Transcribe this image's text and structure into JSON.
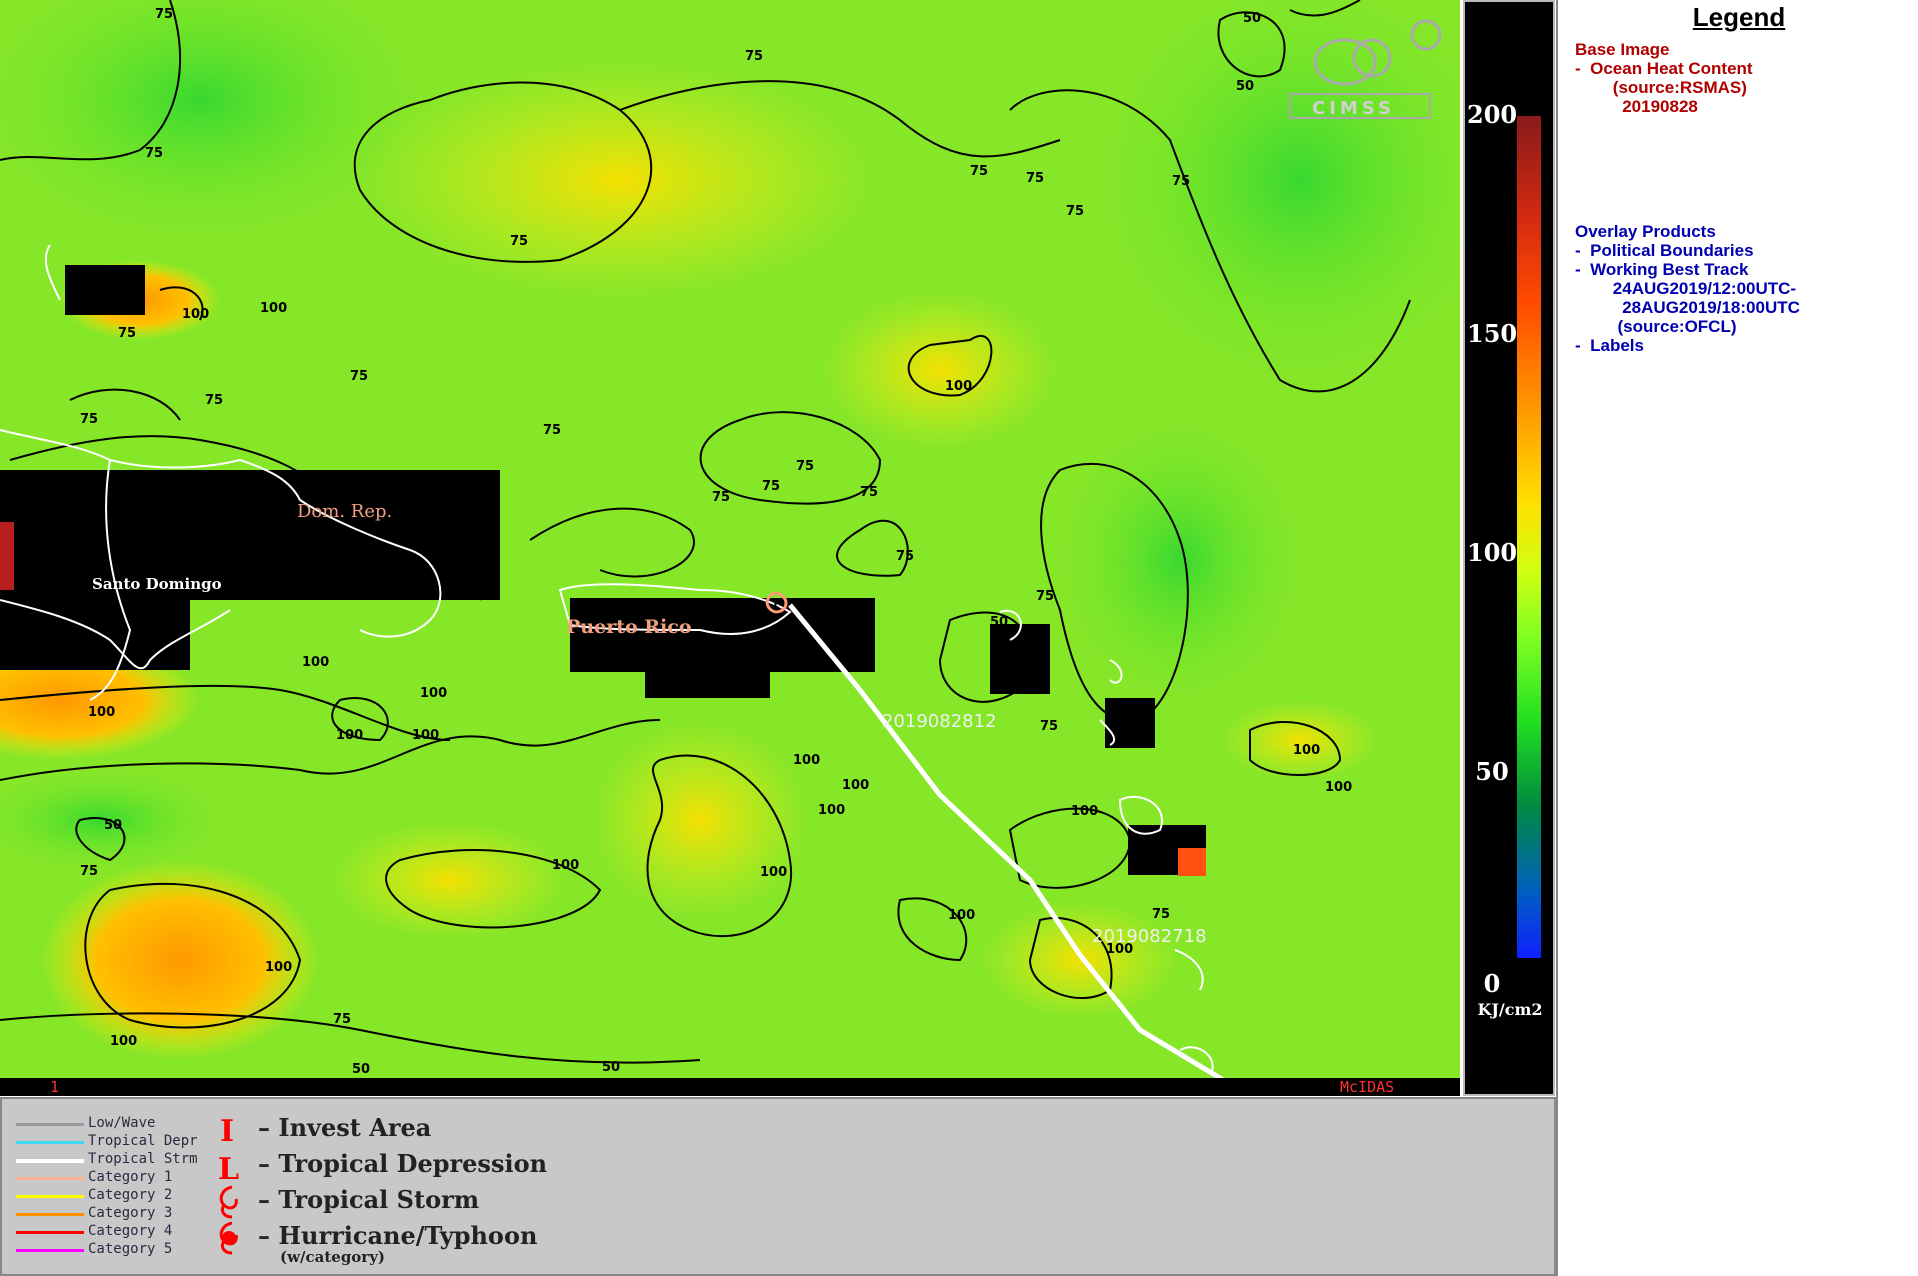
{
  "map": {
    "logo_text": "CIMSS",
    "panel_number": "1",
    "software_label": "McIDAS",
    "place_labels": [
      {
        "name": "dom-rep",
        "text": "Dom. Rep."
      },
      {
        "name": "santo-domingo",
        "text": "Santo Domingo"
      },
      {
        "name": "puerto-rico",
        "text": "Puerto Rico"
      }
    ],
    "track_date_labels": [
      "2019082812",
      "2019082718"
    ],
    "storm_symbol_number": "1",
    "contour_labels": [
      "50",
      "75",
      "100"
    ],
    "colors": {
      "track": "#ffffff",
      "storm_symbol": "#ff9c78",
      "land_mask": "#000000",
      "boundaries": "#ffffff",
      "contours": "#000000"
    }
  },
  "colorbar": {
    "ticks": [
      "200",
      "150",
      "100",
      "50",
      "0"
    ],
    "unit": "KJ/cm2"
  },
  "legend": {
    "title": "Legend",
    "base_image_heading": "Base Image",
    "base_image_items": [
      "-  Ocean Heat Content",
      "        (source:RSMAS)",
      "          20190828"
    ],
    "overlay_heading": "Overlay Products",
    "overlay_items": [
      "-  Political Boundaries",
      "-  Working Best Track",
      "        24AUG2019/12:00UTC-",
      "          28AUG2019/18:00UTC",
      "         (source:OFCL)",
      "-  Labels"
    ]
  },
  "track_key": [
    {
      "label": "Low/Wave",
      "color": "#9a9a9a"
    },
    {
      "label": "Tropical Depr",
      "color": "#40d8f0"
    },
    {
      "label": "Tropical Strm",
      "color": "#ffffff"
    },
    {
      "label": "Category 1",
      "color": "#ffb090"
    },
    {
      "label": "Category 2",
      "color": "#ffff00"
    },
    {
      "label": "Category 3",
      "color": "#ff9000"
    },
    {
      "label": "Category 4",
      "color": "#ff0000"
    },
    {
      "label": "Category 5",
      "color": "#ff00ff"
    }
  ],
  "symbol_key": [
    {
      "label": "– Invest Area",
      "icon": "invest-area-icon"
    },
    {
      "label": "– Tropical Depression",
      "icon": "tropical-depression-icon"
    },
    {
      "label": "– Tropical Storm",
      "icon": "tropical-storm-icon"
    },
    {
      "label": "– Hurricane/Typhoon",
      "icon": "hurricane-icon"
    }
  ],
  "symbol_key_note": "(w/category)"
}
